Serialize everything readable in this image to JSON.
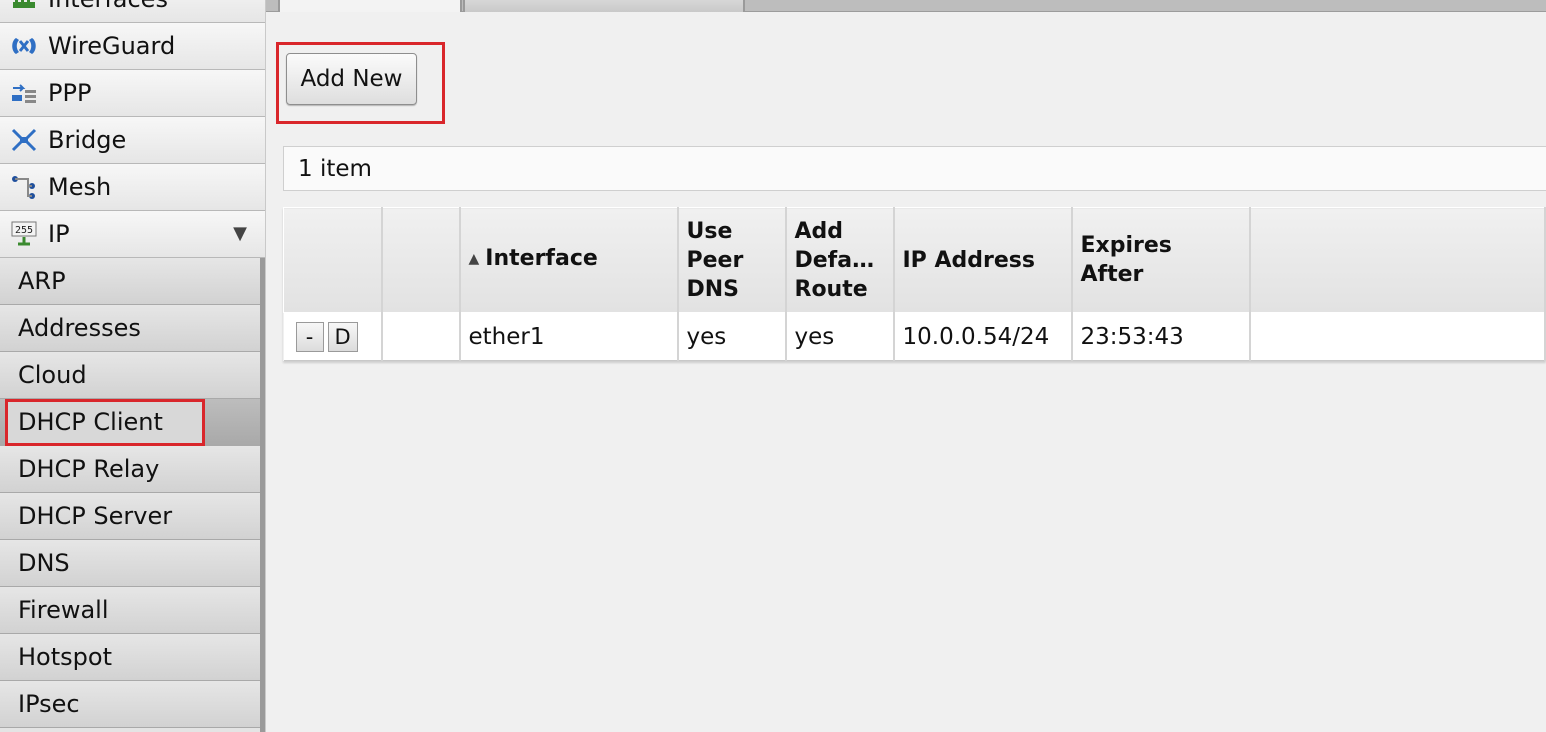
{
  "sidebar": {
    "top_items": [
      {
        "label": "Interfaces",
        "icon": "interfaces-icon"
      },
      {
        "label": "WireGuard",
        "icon": "wireguard-icon"
      },
      {
        "label": "PPP",
        "icon": "ppp-icon"
      },
      {
        "label": "Bridge",
        "icon": "bridge-icon"
      },
      {
        "label": "Mesh",
        "icon": "mesh-icon"
      },
      {
        "label": "IP",
        "icon": "ip-icon",
        "expanded_arrow": "▼"
      }
    ],
    "sub_items": [
      {
        "label": "ARP"
      },
      {
        "label": "Addresses"
      },
      {
        "label": "Cloud"
      },
      {
        "label": "DHCP Client",
        "active": true
      },
      {
        "label": "DHCP Relay"
      },
      {
        "label": "DHCP Server"
      },
      {
        "label": "DNS"
      },
      {
        "label": "Firewall"
      },
      {
        "label": "Hotspot"
      },
      {
        "label": "IPsec"
      }
    ]
  },
  "toolbar": {
    "add_new_label": "Add New"
  },
  "list": {
    "item_count": "1 item"
  },
  "table": {
    "columns": [
      {
        "key": "actions",
        "label": ""
      },
      {
        "key": "flags",
        "label": ""
      },
      {
        "key": "interface",
        "label": "Interface",
        "sorted": "asc",
        "sort_arrow": "▲"
      },
      {
        "key": "use_peer_dns",
        "label": "Use Peer DNS",
        "lines": [
          "Use",
          "Peer",
          "DNS"
        ]
      },
      {
        "key": "add_default_route",
        "label": "Add Defa... Route",
        "lines": [
          "Add",
          "Defa…",
          "Route"
        ]
      },
      {
        "key": "ip_address",
        "label": "IP Address"
      },
      {
        "key": "expires_after",
        "label": "Expires After",
        "lines": [
          "Expires",
          "After"
        ]
      },
      {
        "key": "filler",
        "label": ""
      }
    ],
    "rows": [
      {
        "remove_label": "-",
        "disable_label": "D",
        "interface": "ether1",
        "use_peer_dns": "yes",
        "add_default_route": "yes",
        "ip_address": "10.0.0.54/24",
        "expires_after": "23:53:43"
      }
    ]
  },
  "colors": {
    "highlight": "#d9262b",
    "background": "#f0f0f0"
  }
}
